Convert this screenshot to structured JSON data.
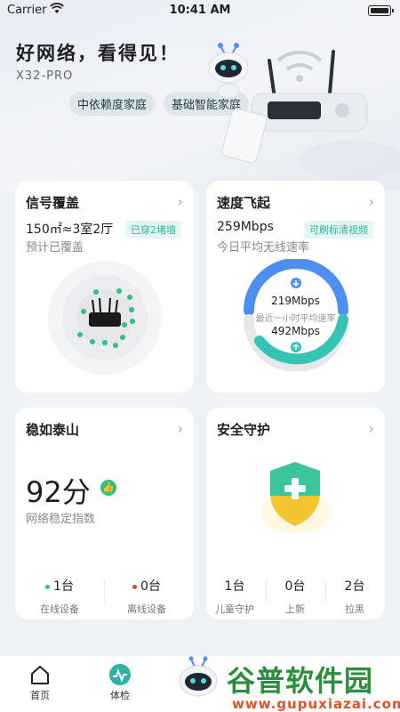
{
  "status_bar": {
    "carrier": "Carrier",
    "time": "10:41 AM"
  },
  "hero": {
    "headline": "好网络，看得见！",
    "model": "X32-PRO",
    "tags": [
      "中依赖度家庭",
      "基础智能家庭"
    ]
  },
  "cards": {
    "signal": {
      "title": "信号覆盖",
      "area": "150㎡≈3室2厅",
      "badge": "已穿2堵墙",
      "subtitle": "预计已覆盖"
    },
    "speed": {
      "title": "速度飞起",
      "value": "259Mbps",
      "badge": "可刷标清视频",
      "subtitle": "今日平均无线速率",
      "upload": "219Mbps",
      "gauge_caption": "最近一小时平均速率",
      "download": "492Mbps"
    },
    "stability": {
      "title": "稳如泰山",
      "score": "92分",
      "subtitle": "网络稳定指数",
      "online_count": "1台",
      "online_label": "在线设备",
      "offline_count": "0台",
      "offline_label": "离线设备"
    },
    "security": {
      "title": "安全守护",
      "items": [
        {
          "count": "1台",
          "label": "儿童守护"
        },
        {
          "count": "0台",
          "label": "上新"
        },
        {
          "count": "2台",
          "label": "拉黑"
        }
      ]
    }
  },
  "nav": {
    "home": "首页",
    "checkup": "体检"
  },
  "watermark": {
    "title": "谷普软件园",
    "url": "www.gupuxiazai.com"
  },
  "colors": {
    "accent_teal": "#2db3a6",
    "gauge_blue": "#4d8ff0",
    "gauge_teal": "#34c3b5",
    "online_green": "#2ec27e",
    "offline_red": "#e0443a"
  }
}
